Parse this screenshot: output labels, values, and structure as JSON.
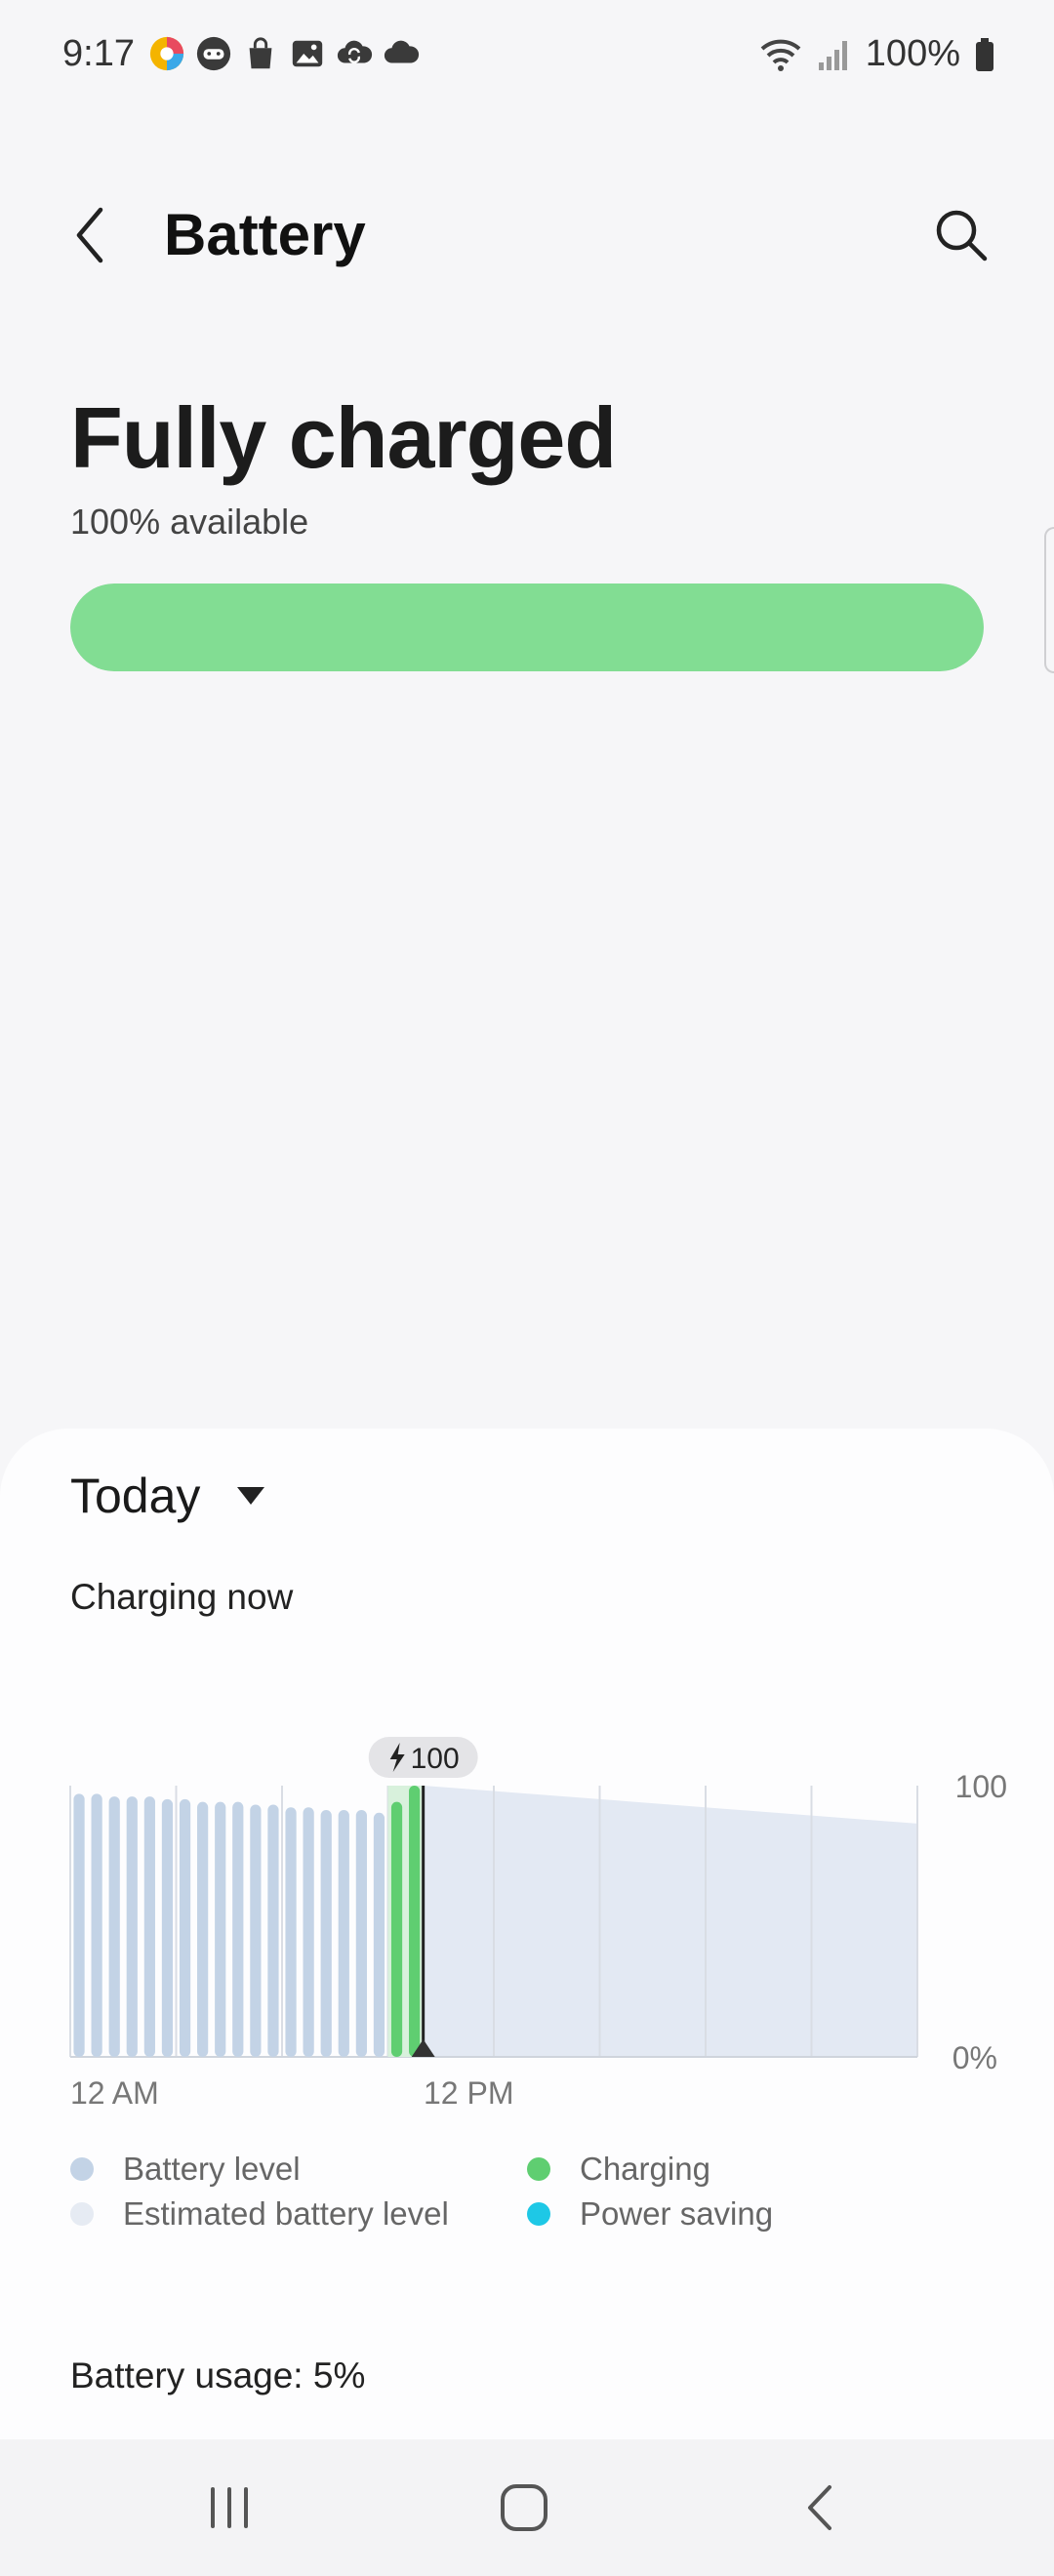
{
  "status_bar": {
    "time": "9:17",
    "battery_percent": "100%",
    "left_icons": [
      "photo-app-icon",
      "game-launcher-icon",
      "shopping-bag-icon",
      "gallery-icon",
      "cloud-sync-icon",
      "cloud-icon"
    ],
    "right_icons": [
      "wifi-icon",
      "signal-icon",
      "battery-icon"
    ]
  },
  "app_bar": {
    "title": "Battery",
    "back_icon": "chevron-left-icon",
    "search_icon": "search-icon"
  },
  "summary": {
    "headline": "Fully charged",
    "available": "100% available",
    "level": 1.0,
    "bar_color": "#82dd93"
  },
  "card": {
    "period": "Today",
    "status": "Charging now",
    "usage": "Battery usage: 5%"
  },
  "chart_data": {
    "type": "bar",
    "y_tick_labels": [
      "100",
      "0%"
    ],
    "x_tick_labels": [
      "12 AM",
      "12 PM"
    ],
    "ylim": [
      0,
      100
    ],
    "callout": "100",
    "history": {
      "name": "Battery level",
      "color": "#c3d3e6",
      "values": [
        97,
        97,
        96,
        96,
        96,
        95,
        95,
        94,
        94,
        94,
        93,
        93,
        92,
        92,
        91,
        91,
        91,
        90
      ]
    },
    "charging": {
      "name": "Charging",
      "color": "#5fce71",
      "values": [
        94,
        100
      ]
    },
    "estimate": {
      "name": "Estimated battery level",
      "color": "#e3e9f3",
      "start": 100,
      "end": 86
    },
    "legend": [
      {
        "label": "Battery level",
        "color": "#c3d3e6"
      },
      {
        "label": "Estimated battery level",
        "color": "#e6ebf3"
      },
      {
        "label": "Charging",
        "color": "#5fce71"
      },
      {
        "label": "Power saving",
        "color": "#1ec8e6"
      }
    ]
  },
  "nav_bar": {
    "recents_icon": "recents-icon",
    "home_icon": "home-icon",
    "back_icon": "back-icon"
  }
}
